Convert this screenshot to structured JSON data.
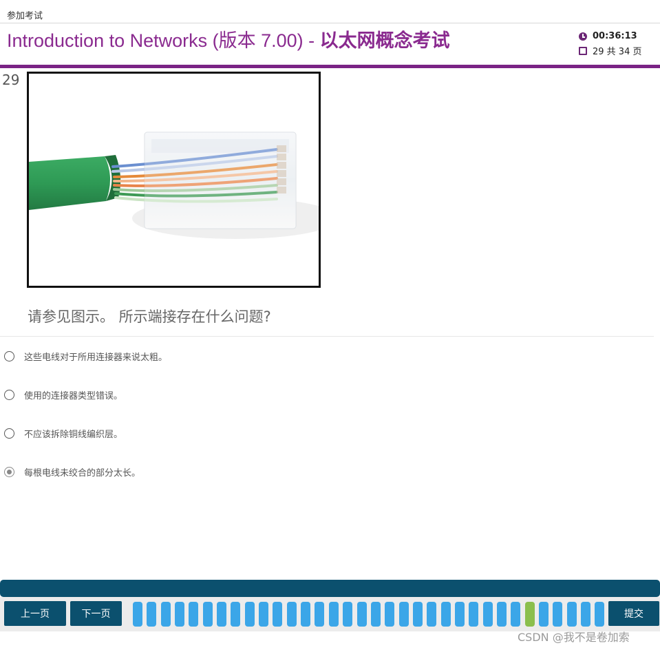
{
  "topbar": {
    "label": "参加考试"
  },
  "header": {
    "title_part1": "Introduction to Networks (版本 7.00) - ",
    "title_part2": "以太网概念考试",
    "timer": "00:36:13",
    "page_info": "29 共 34 页"
  },
  "question": {
    "number": "29",
    "text": "请参见图示。 所示端接存在什么问题?",
    "options": [
      {
        "text": "这些电线对于所用连接器来说太粗。",
        "selected": false
      },
      {
        "text": "使用的连接器类型错误。",
        "selected": false
      },
      {
        "text": "不应该拆除铜线编织层。",
        "selected": false
      },
      {
        "text": "每根电线未绞合的部分太长。",
        "selected": true
      }
    ]
  },
  "nav": {
    "prev_label": "上一页",
    "next_label": "下一页",
    "submit_label": "提交",
    "total_segments": 34,
    "current_segment": 29,
    "segment_color": "#3ba6e8",
    "current_color": "#8bbf4d"
  },
  "colors": {
    "brand_purple": "#8a2a8f",
    "nav_blue": "#0b506e"
  },
  "watermark": "CSDN @我不是卷加索"
}
